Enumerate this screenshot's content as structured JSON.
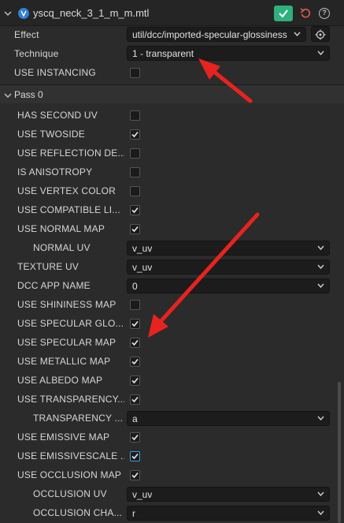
{
  "header": {
    "file_name": "yscq_neck_3_1_m_m.mtl",
    "help_label": "?"
  },
  "effect": {
    "label": "Effect",
    "value": "util/dcc/imported-specular-glossiness"
  },
  "technique": {
    "label": "Technique",
    "value": "1 - transparent"
  },
  "use_instancing": {
    "label": "USE INSTANCING",
    "checked": false
  },
  "pass": {
    "title": "Pass 0"
  },
  "props": [
    {
      "label": "HAS SECOND UV",
      "type": "checkbox",
      "checked": false
    },
    {
      "label": "USE TWOSIDE",
      "type": "checkbox",
      "checked": true
    },
    {
      "label": "USE REFLECTION DE...",
      "type": "checkbox",
      "checked": false
    },
    {
      "label": "IS ANISOTROPY",
      "type": "checkbox",
      "checked": false
    },
    {
      "label": "USE VERTEX COLOR",
      "type": "checkbox",
      "checked": false
    },
    {
      "label": "USE COMPATIBLE LI...",
      "type": "checkbox",
      "checked": true
    },
    {
      "label": "USE NORMAL MAP",
      "type": "checkbox",
      "checked": true
    },
    {
      "label": "NORMAL UV",
      "type": "select",
      "value": "v_uv",
      "indent": true
    },
    {
      "label": "TEXTURE UV",
      "type": "select",
      "value": "v_uv"
    },
    {
      "label": "DCC APP NAME",
      "type": "select",
      "value": "0"
    },
    {
      "label": "USE SHININESS MAP",
      "type": "checkbox",
      "checked": false
    },
    {
      "label": "USE SPECULAR GLO...",
      "type": "checkbox",
      "checked": true
    },
    {
      "label": "USE SPECULAR MAP",
      "type": "checkbox",
      "checked": true
    },
    {
      "label": "USE METALLIC MAP",
      "type": "checkbox",
      "checked": true
    },
    {
      "label": "USE ALBEDO MAP",
      "type": "checkbox",
      "checked": true
    },
    {
      "label": "USE TRANSPARENCY...",
      "type": "checkbox",
      "checked": true
    },
    {
      "label": "TRANSPARENCY ...",
      "type": "select",
      "value": "a",
      "indent": true
    },
    {
      "label": "USE EMISSIVE MAP",
      "type": "checkbox",
      "checked": true
    },
    {
      "label": "USE EMISSIVESCALE ...",
      "type": "checkbox",
      "checked": true,
      "accent": true
    },
    {
      "label": "USE OCCLUSION MAP",
      "type": "checkbox",
      "checked": true
    },
    {
      "label": "OCCLUSION UV",
      "type": "select",
      "value": "v_uv",
      "indent": true
    },
    {
      "label": "OCCLUSION CHA...",
      "type": "select",
      "value": "r",
      "indent": true
    }
  ],
  "colors": {
    "accent_green": "#2fb07c",
    "arrow_red": "#e8231f",
    "reset_red": "#e05a4a"
  }
}
